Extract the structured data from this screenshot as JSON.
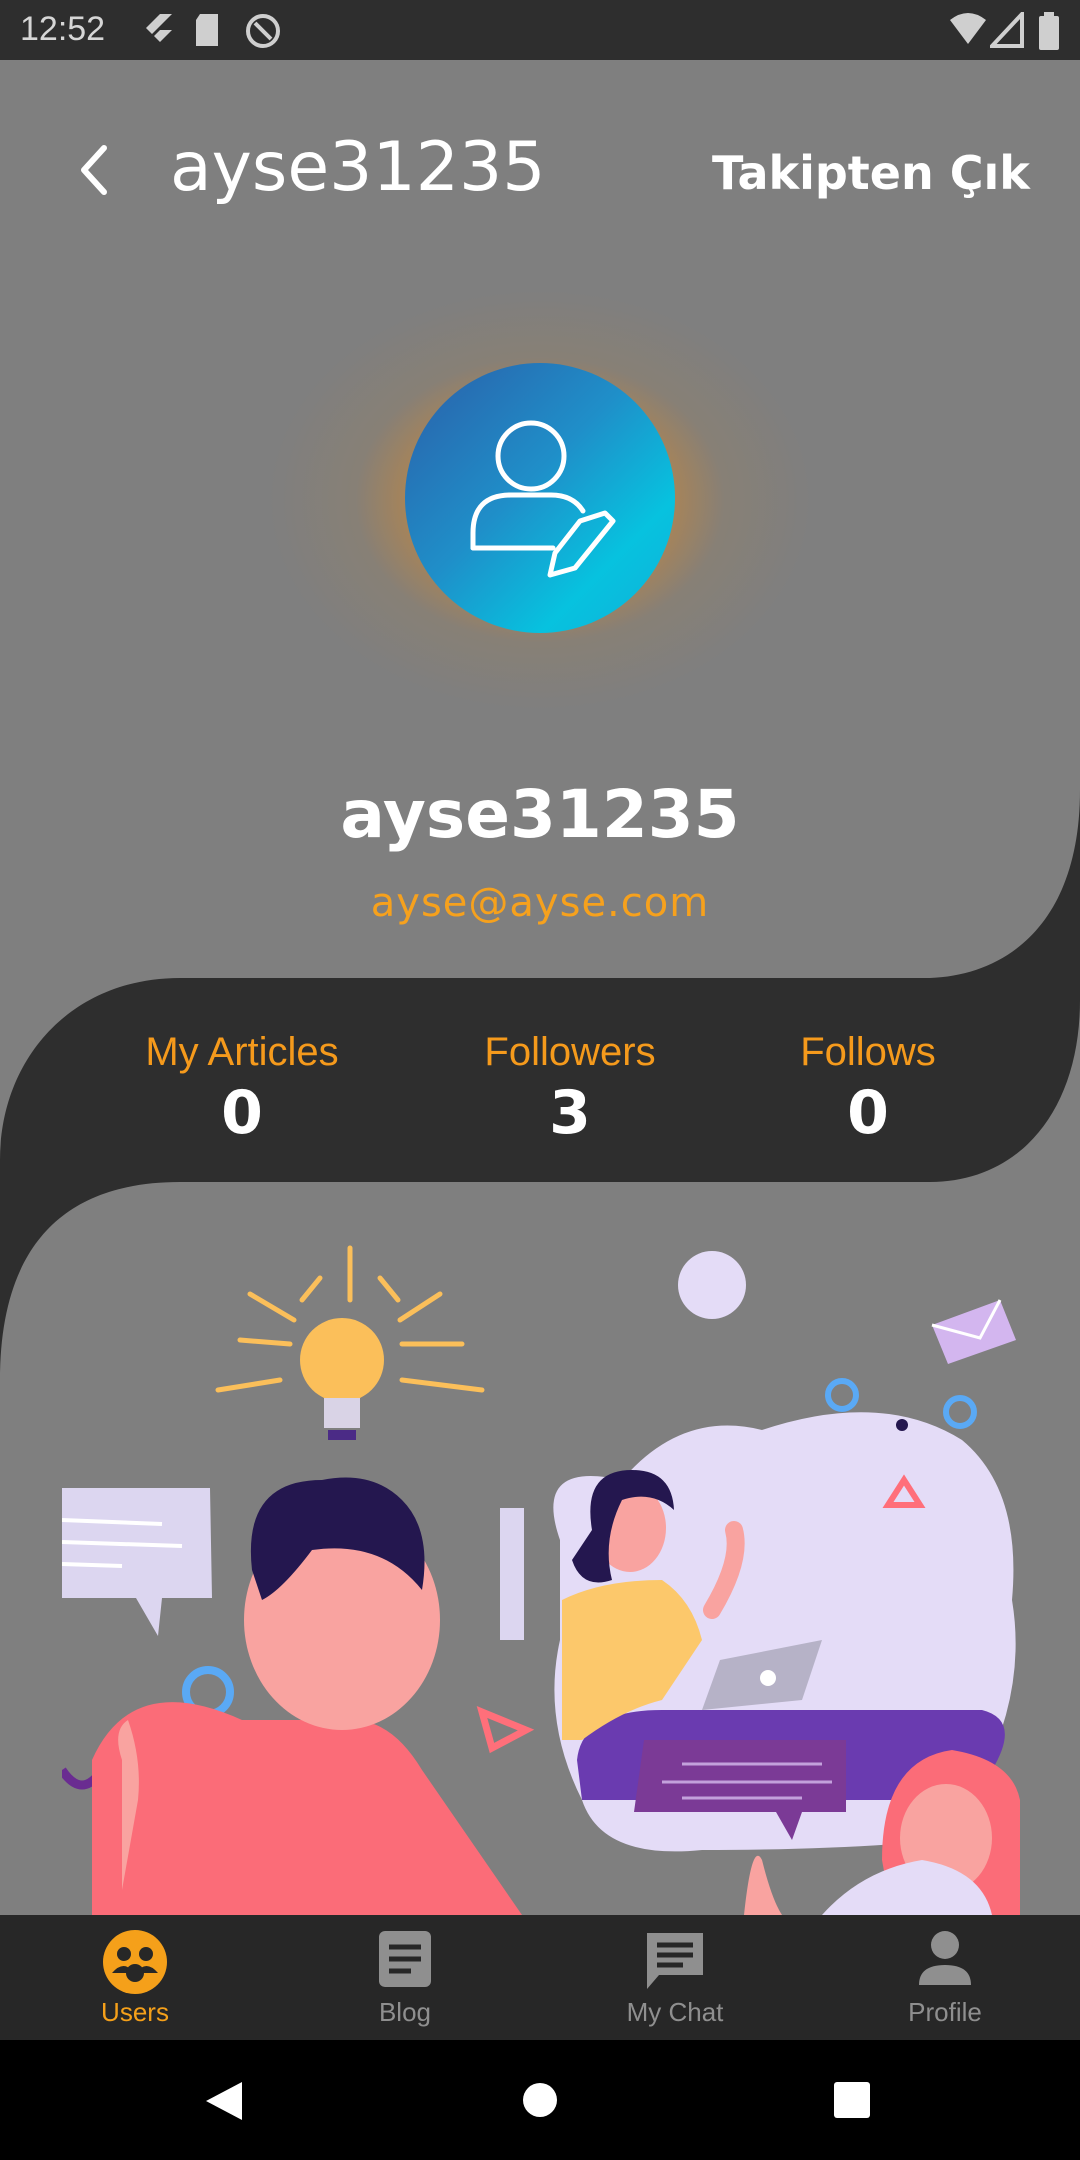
{
  "status_bar": {
    "time": "12:52"
  },
  "header": {
    "title": "ayse31235",
    "unfollow_label": "Takipten Çık"
  },
  "profile": {
    "name": "ayse31235",
    "email": "ayse@ayse.com"
  },
  "stats": [
    {
      "label": "My Articles",
      "value": "0"
    },
    {
      "label": "Followers",
      "value": "3"
    },
    {
      "label": "Follows",
      "value": "0"
    }
  ],
  "bottom_nav": [
    {
      "label": "Users",
      "icon": "users-icon",
      "active": true
    },
    {
      "label": "Blog",
      "icon": "article-icon",
      "active": false
    },
    {
      "label": "My Chat",
      "icon": "chat-icon",
      "active": false
    },
    {
      "label": "Profile",
      "icon": "person-icon",
      "active": false
    }
  ],
  "colors": {
    "accent": "#f59a1c",
    "background": "#7f7f7f",
    "dark": "#2e2e2e"
  }
}
